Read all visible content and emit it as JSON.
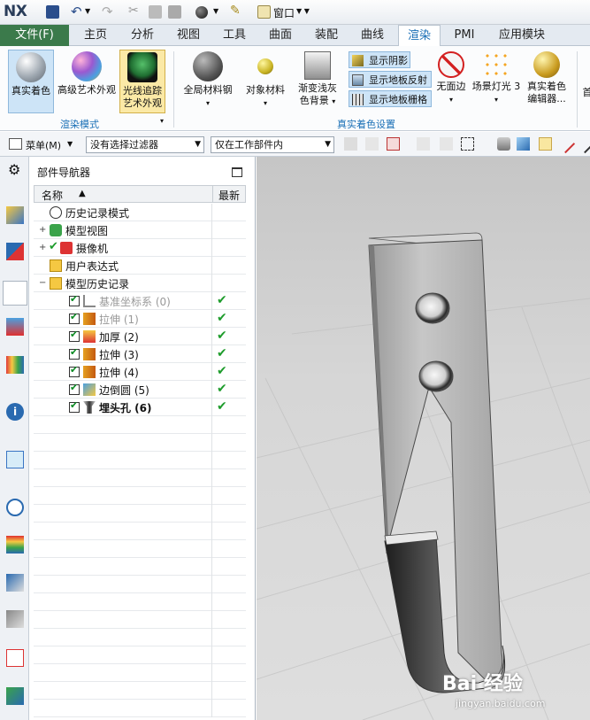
{
  "app": {
    "logo": "NX",
    "window_menu": "窗口"
  },
  "tabs": [
    {
      "label": "文件(F)"
    },
    {
      "label": "主页"
    },
    {
      "label": "分析"
    },
    {
      "label": "视图"
    },
    {
      "label": "工具"
    },
    {
      "label": "曲面"
    },
    {
      "label": "装配"
    },
    {
      "label": "曲线"
    },
    {
      "label": "渲染"
    },
    {
      "label": "PMI"
    },
    {
      "label": "应用模块"
    }
  ],
  "ribbon": {
    "render_mode": {
      "group_label": "渲染模式",
      "items": [
        {
          "label": "真实着色"
        },
        {
          "label": "高级艺术外观"
        },
        {
          "label": "光线追踪",
          "label2": "艺术外观"
        }
      ]
    },
    "true_shading": {
      "group_label": "真实着色设置",
      "items": [
        {
          "label": "全局材料钢"
        },
        {
          "label": "对象材料"
        },
        {
          "label": "渐变浅灰",
          "label2": "色背景"
        },
        {
          "label": "无面边"
        },
        {
          "label": "场景灯光 3"
        },
        {
          "label": "真实着色",
          "label2": "编辑器..."
        }
      ],
      "toggles": [
        {
          "label": "显示阴影"
        },
        {
          "label": "显示地板反射"
        },
        {
          "label": "显示地板栅格"
        }
      ]
    },
    "cut_label": "首"
  },
  "toolbar": {
    "menu_label": "菜单(M)",
    "filter": "没有选择过滤器",
    "scope": "仅在工作部件内"
  },
  "navigator": {
    "title": "部件导航器",
    "col_name": "名称",
    "col_latest": "最新",
    "rows": [
      {
        "label": "历史记录模式"
      },
      {
        "label": "模型视图"
      },
      {
        "label": "摄像机"
      },
      {
        "label": "用户表达式"
      },
      {
        "label": "模型历史记录"
      },
      {
        "label": "基准坐标系 (0)"
      },
      {
        "label": "拉伸 (1)"
      },
      {
        "label": "加厚 (2)"
      },
      {
        "label": "拉伸 (3)"
      },
      {
        "label": "拉伸 (4)"
      },
      {
        "label": "边倒圆 (5)"
      },
      {
        "label": "埋头孔 (6)"
      }
    ]
  },
  "watermark": {
    "brand": "Bai 经验",
    "url": "jingyan.baidu.com"
  }
}
